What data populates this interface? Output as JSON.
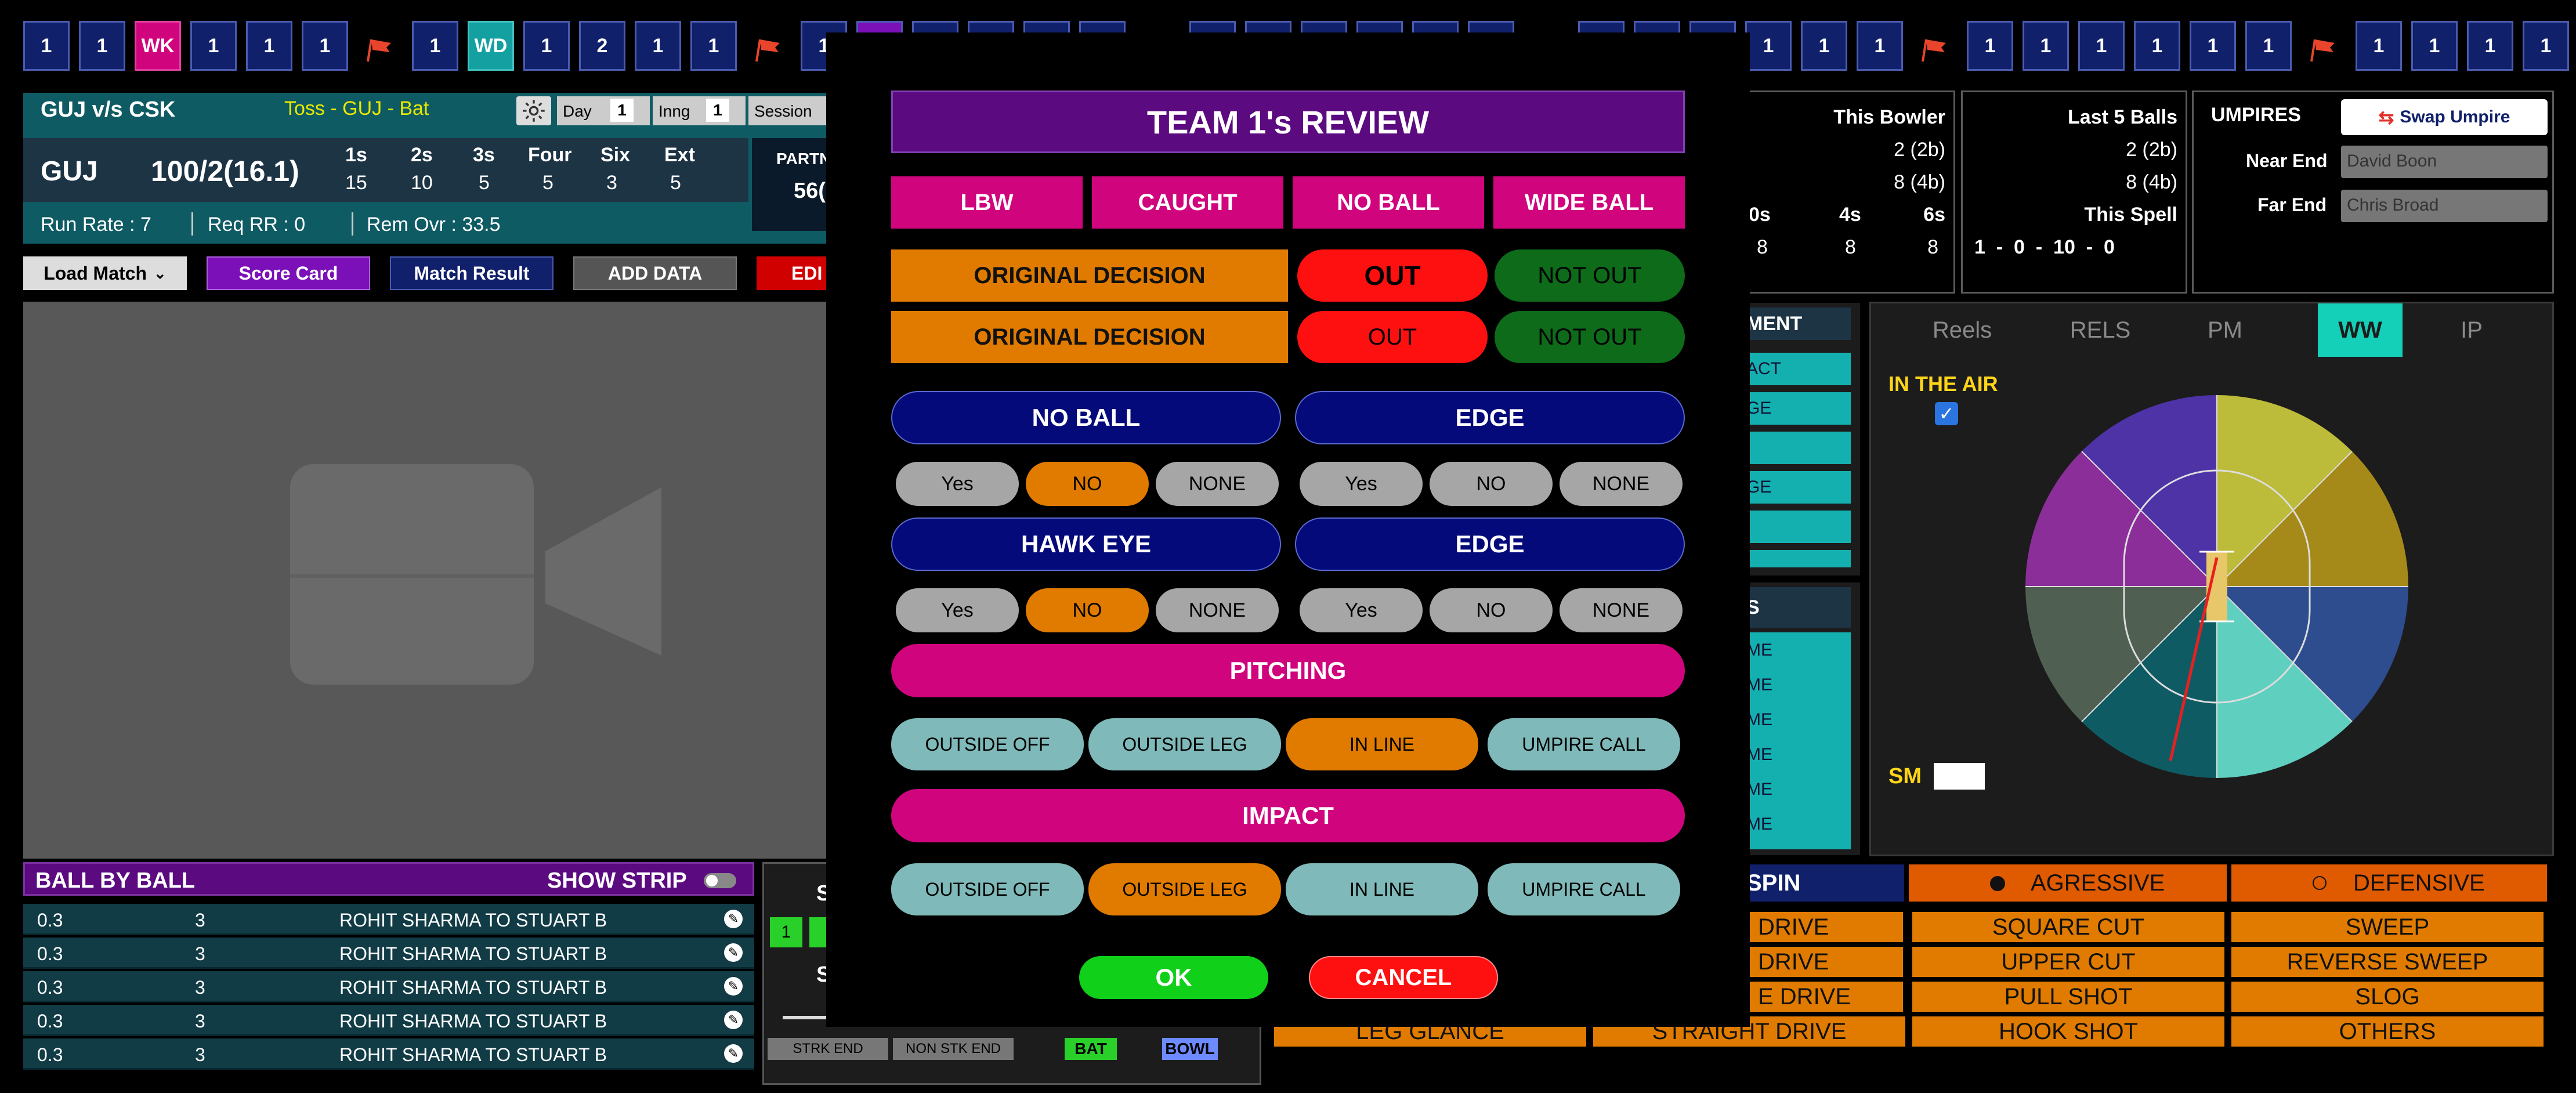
{
  "top_strip": {
    "balls": [
      "1",
      "1",
      "WK",
      "1",
      "1",
      "1",
      "1",
      "WD",
      "1",
      "2",
      "1",
      "1",
      "1",
      "",
      "",
      "",
      "",
      "",
      "",
      "",
      "",
      "",
      "",
      "",
      "",
      "",
      "",
      "1",
      "1",
      "1",
      "1",
      "1",
      "1",
      "1",
      "1",
      "1",
      "1",
      "1",
      "1",
      "1"
    ],
    "colors": {
      "navy": "#10206a",
      "wk": "#d0057e",
      "wd": "#14a0a0",
      "purple": "#7b10b8"
    }
  },
  "header": {
    "teams": "GUJ v/s CSK",
    "toss": "Toss - GUJ - Bat",
    "day_label": "Day",
    "day_value": "1",
    "inng_label": "Inng",
    "inng_value": "1",
    "session_label": "Session",
    "team": "GUJ",
    "score": "100/2(16.1)",
    "stats_headers": [
      "1s",
      "2s",
      "3s",
      "Four",
      "Six",
      "Ext"
    ],
    "stats_values": [
      "15",
      "10",
      "5",
      "5",
      "3",
      "5"
    ],
    "run_rate": "Run Rate :  7",
    "req_rr": "Req RR :  0",
    "rem_ovr": "Rem Ovr :  33.5",
    "partnership_label": "PARTN",
    "partnership_value": "56("
  },
  "actions": {
    "load_match": "Load Match",
    "score_card": "Score Card",
    "match_result": "Match Result",
    "add_data": "ADD DATA",
    "edit": "EDI"
  },
  "ball_by_ball": {
    "title": "BALL BY BALL",
    "show_strip": "SHOW STRIP",
    "rows": [
      {
        "over": "0.3",
        "runs": "3",
        "desc": "ROHIT SHARMA TO STUART B"
      },
      {
        "over": "0.3",
        "runs": "3",
        "desc": "ROHIT SHARMA TO STUART B"
      },
      {
        "over": "0.3",
        "runs": "3",
        "desc": "ROHIT SHARMA TO STUART B"
      },
      {
        "over": "0.3",
        "runs": "3",
        "desc": "ROHIT SHARMA TO STUART B"
      },
      {
        "over": "0.3",
        "runs": "3",
        "desc": "ROHIT SHARMA TO STUART B"
      }
    ]
  },
  "mid_panel": {
    "s_label": "S",
    "strk_end": "STRK END",
    "non_stk_end": "NON STK END",
    "bat": "BAT",
    "bowl": "BOWL",
    "one": "1"
  },
  "bowler": {
    "this_bowler": "This Bowler",
    "tb_1": "2 (2b)",
    "tb_2": "8 (4b)",
    "last5": "Last 5 Balls",
    "l5_1": "2 (2b)",
    "l5_2": "8 (4b)",
    "col_0s": "0s",
    "col_4s": "4s",
    "col_6s": "6s",
    "val_0s": "8",
    "val_4s": "8",
    "val_6s": "8",
    "this_spell": "This Spell",
    "spell": "1  -  0  -  10  -  0"
  },
  "umpires": {
    "title": "UMPIRES",
    "swap": "Swap Umpire",
    "near_end": "Near End",
    "near_value": "David Boon",
    "far_end": "Far End",
    "far_value": "Chris Broad"
  },
  "partial_list": {
    "header": "MENT",
    "items": [
      "ACT",
      "GE",
      "",
      "GE",
      ""
    ],
    "header2": "S",
    "items2": [
      "ME",
      "ME",
      "ME",
      "ME",
      "ME",
      "ME"
    ]
  },
  "wagon": {
    "tabs": [
      "Reels",
      "RELS",
      "PM",
      "WW",
      "IP"
    ],
    "active_tab": "WW",
    "in_the_air": "IN THE AIR",
    "sm": "SM",
    "sector_colors": [
      "#bcbb3a",
      "#a58a1a",
      "#2e4d8e",
      "#5fcfc0",
      "#0f5b64",
      "#4f5f52",
      "#8b2e9a",
      "#4d33a6"
    ]
  },
  "shots": {
    "spin": "SPIN",
    "aggressive": "AGRESSIVE",
    "defensive": "DEFENSIVE",
    "grid": [
      [
        "DRIVE",
        "SQUARE CUT",
        "SWEEP"
      ],
      [
        "DRIVE",
        "UPPER CUT",
        "REVERSE SWEEP"
      ],
      [
        "E DRIVE",
        "PULL SHOT",
        "SLOG"
      ],
      [
        "LEG GLANCE",
        "STRAIGHT DRIVE",
        "HOOK SHOT",
        "OTHERS"
      ]
    ]
  },
  "modal": {
    "title": "TEAM 1's REVIEW",
    "types": [
      "LBW",
      "CAUGHT",
      "NO BALL",
      "WIDE BALL"
    ],
    "original_decision": "ORIGINAL DECISION",
    "out": "OUT",
    "not_out": "NOT OUT",
    "no_ball": "NO BALL",
    "edge": "EDGE",
    "hawk_eye": "HAWK EYE",
    "yes": "Yes",
    "no": "NO",
    "none": "NONE",
    "pitching": "PITCHING",
    "impact": "IMPACT",
    "pitch_options": [
      "OUTSIDE OFF",
      "OUTSIDE LEG",
      "IN LINE",
      "UMPIRE CALL"
    ],
    "ok": "OK",
    "cancel": "CANCEL",
    "colors": {
      "purple": "#5b0a80",
      "magenta": "#d0057e",
      "orange": "#e07b00",
      "red": "#ff1010",
      "green": "#0d6b1a",
      "navy": "#040a7a",
      "sage": "#7fb9b9",
      "ok": "#10d01a"
    }
  }
}
